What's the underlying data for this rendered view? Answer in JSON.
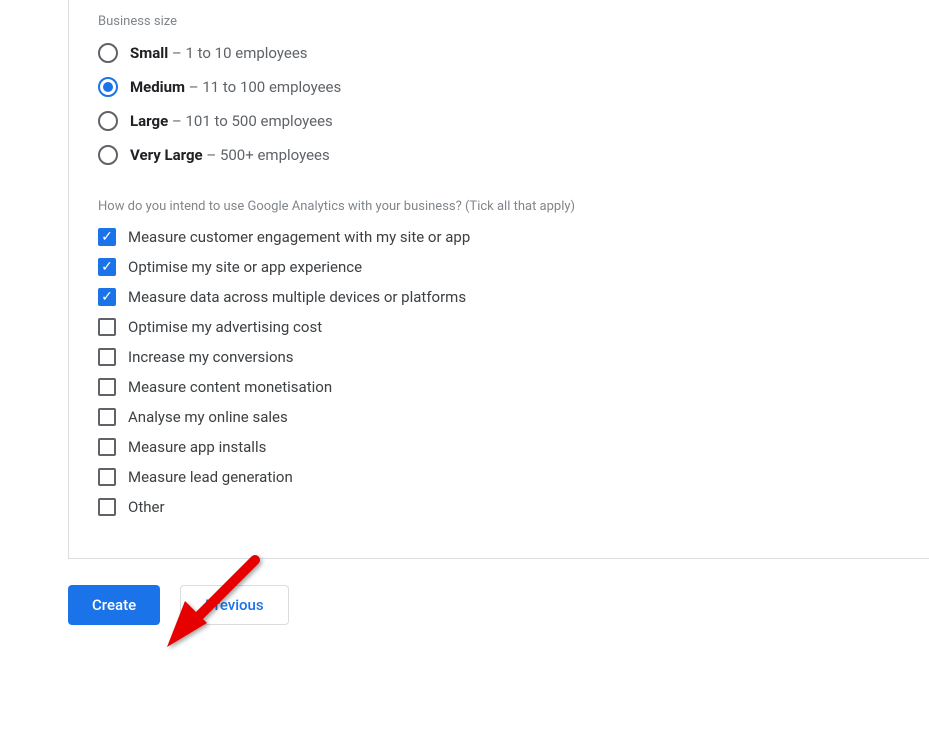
{
  "business_size": {
    "label": "Business size",
    "options": [
      {
        "title": "Small",
        "sub": " – 1 to 10 employees",
        "selected": false
      },
      {
        "title": "Medium",
        "sub": " – 11 to 100 employees",
        "selected": true
      },
      {
        "title": "Large",
        "sub": " – 101 to 500 employees",
        "selected": false
      },
      {
        "title": "Very Large",
        "sub": " – 500+ employees",
        "selected": false
      }
    ]
  },
  "usage": {
    "label": "How do you intend to use Google Analytics with your business? (Tick all that apply)",
    "options": [
      {
        "label": "Measure customer engagement with my site or app",
        "checked": true
      },
      {
        "label": "Optimise my site or app experience",
        "checked": true
      },
      {
        "label": "Measure data across multiple devices or platforms",
        "checked": true
      },
      {
        "label": "Optimise my advertising cost",
        "checked": false
      },
      {
        "label": "Increase my conversions",
        "checked": false
      },
      {
        "label": "Measure content monetisation",
        "checked": false
      },
      {
        "label": "Analyse my online sales",
        "checked": false
      },
      {
        "label": "Measure app installs",
        "checked": false
      },
      {
        "label": "Measure lead generation",
        "checked": false
      },
      {
        "label": "Other",
        "checked": false
      }
    ]
  },
  "buttons": {
    "create": "Create",
    "previous": "Previous"
  }
}
